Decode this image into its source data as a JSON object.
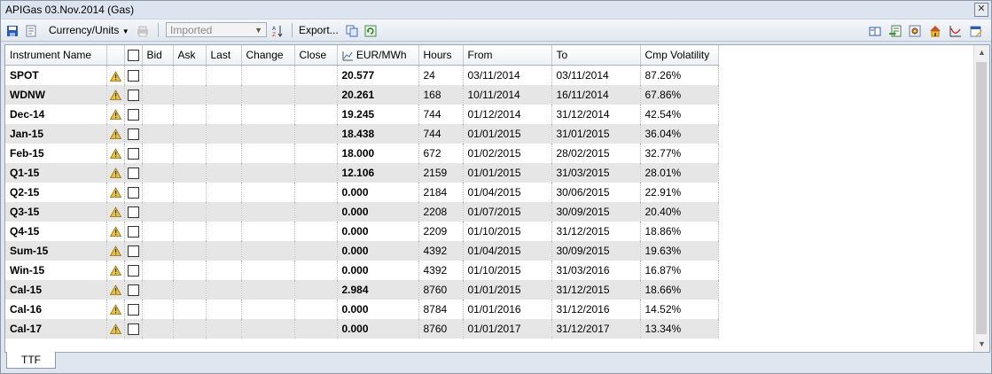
{
  "window": {
    "title": "APIGas 03.Nov.2014 (Gas)",
    "close_glyph": "✕"
  },
  "toolbar": {
    "currency_units_label": "Currency/Units",
    "source_combo_value": "Imported",
    "export_label": "Export..."
  },
  "columns": [
    "Instrument Name",
    "",
    "",
    "Bid",
    "Ask",
    "Last",
    "Change",
    "Close",
    "EUR/MWh",
    "Hours",
    "From",
    "To",
    "Cmp Volatility"
  ],
  "rows": [
    {
      "name": "SPOT",
      "value": "20.577",
      "hours": "24",
      "from": "03/11/2014",
      "to": "03/11/2014",
      "vol": "87.26%"
    },
    {
      "name": "WDNW",
      "value": "20.261",
      "hours": "168",
      "from": "10/11/2014",
      "to": "16/11/2014",
      "vol": "67.86%"
    },
    {
      "name": "Dec-14",
      "value": "19.245",
      "hours": "744",
      "from": "01/12/2014",
      "to": "31/12/2014",
      "vol": "42.54%"
    },
    {
      "name": "Jan-15",
      "value": "18.438",
      "hours": "744",
      "from": "01/01/2015",
      "to": "31/01/2015",
      "vol": "36.04%"
    },
    {
      "name": "Feb-15",
      "value": "18.000",
      "hours": "672",
      "from": "01/02/2015",
      "to": "28/02/2015",
      "vol": "32.77%"
    },
    {
      "name": "Q1-15",
      "value": "12.106",
      "hours": "2159",
      "from": "01/01/2015",
      "to": "31/03/2015",
      "vol": "28.01%"
    },
    {
      "name": "Q2-15",
      "value": "0.000",
      "hours": "2184",
      "from": "01/04/2015",
      "to": "30/06/2015",
      "vol": "22.91%"
    },
    {
      "name": "Q3-15",
      "value": "0.000",
      "hours": "2208",
      "from": "01/07/2015",
      "to": "30/09/2015",
      "vol": "20.40%"
    },
    {
      "name": "Q4-15",
      "value": "0.000",
      "hours": "2209",
      "from": "01/10/2015",
      "to": "31/12/2015",
      "vol": "18.86%"
    },
    {
      "name": "Sum-15",
      "value": "0.000",
      "hours": "4392",
      "from": "01/04/2015",
      "to": "30/09/2015",
      "vol": "19.63%"
    },
    {
      "name": "Win-15",
      "value": "0.000",
      "hours": "4392",
      "from": "01/10/2015",
      "to": "31/03/2016",
      "vol": "16.87%"
    },
    {
      "name": "Cal-15",
      "value": "2.984",
      "hours": "8760",
      "from": "01/01/2015",
      "to": "31/12/2015",
      "vol": "18.66%"
    },
    {
      "name": "Cal-16",
      "value": "0.000",
      "hours": "8784",
      "from": "01/01/2016",
      "to": "31/12/2016",
      "vol": "14.52%"
    },
    {
      "name": "Cal-17",
      "value": "0.000",
      "hours": "8760",
      "from": "01/01/2017",
      "to": "31/12/2017",
      "vol": "13.34%"
    }
  ],
  "tabs": [
    {
      "label": "TTF"
    }
  ],
  "colors": {
    "alt_row": "#e6e6e6",
    "title_bg": "#dbe4ef",
    "warning": "#e8c23a"
  }
}
